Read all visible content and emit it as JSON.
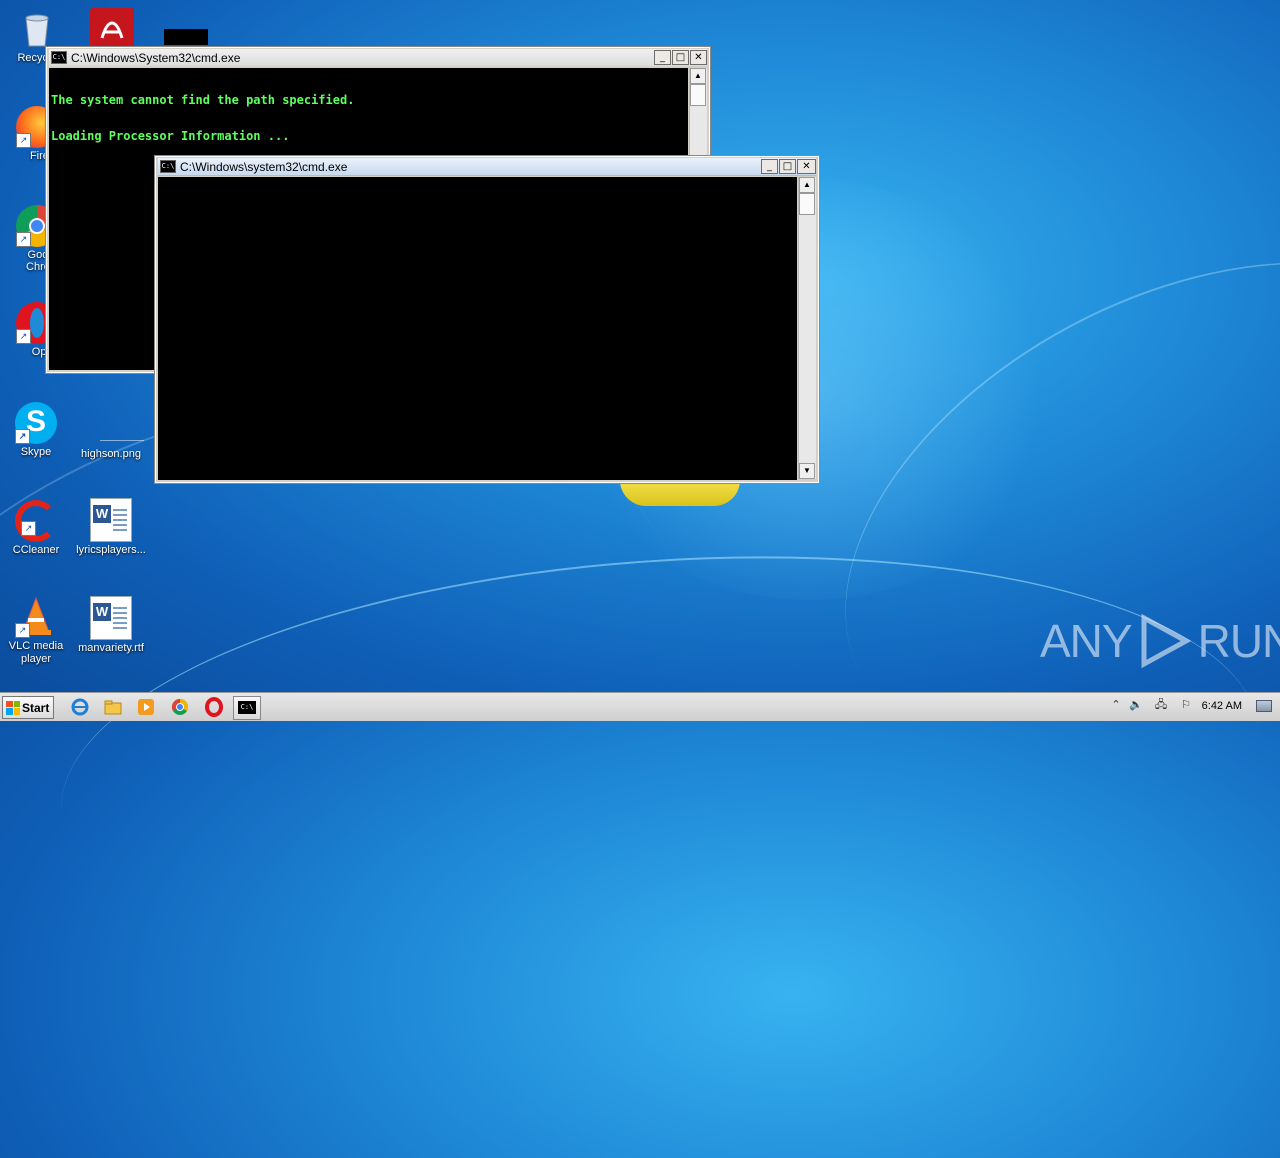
{
  "desktop": {
    "icons": [
      {
        "label": "Recycle",
        "icon": "recycle-bin-icon"
      },
      {
        "label": "Firefo",
        "icon": "firefox-icon"
      },
      {
        "label": "Goog\nChron",
        "icon": "chrome-icon"
      },
      {
        "label": "Oper",
        "icon": "opera-icon"
      },
      {
        "label": "Skype",
        "icon": "skype-icon"
      },
      {
        "label": "highson.png",
        "icon": "image-file-icon"
      },
      {
        "label": "CCleaner",
        "icon": "ccleaner-icon"
      },
      {
        "label": "lyricsplayers...",
        "icon": "word-doc-icon"
      },
      {
        "label": "VLC media\nplayer",
        "icon": "vlc-icon"
      },
      {
        "label": "manvariety.rtf",
        "icon": "word-doc-icon"
      }
    ]
  },
  "windows": [
    {
      "title": "C:\\Windows\\System32\\cmd.exe",
      "lines": [
        "The system cannot find the path specified.",
        "Loading Processor Information ..."
      ]
    },
    {
      "title": "C:\\Windows\\system32\\cmd.exe",
      "lines": []
    }
  ],
  "taskbar": {
    "start_label": "Start",
    "items": [
      "internet-explorer-icon",
      "explorer-folder-icon",
      "media-player-icon",
      "chrome-icon",
      "opera-icon",
      "cmd-icon"
    ],
    "clock": "6:42 AM"
  },
  "watermark": {
    "left": "ANY",
    "right": "RUN"
  },
  "colors": {
    "console_text": "#5cff5c",
    "console_bg": "#000000",
    "desktop": "#1f8ad8"
  }
}
